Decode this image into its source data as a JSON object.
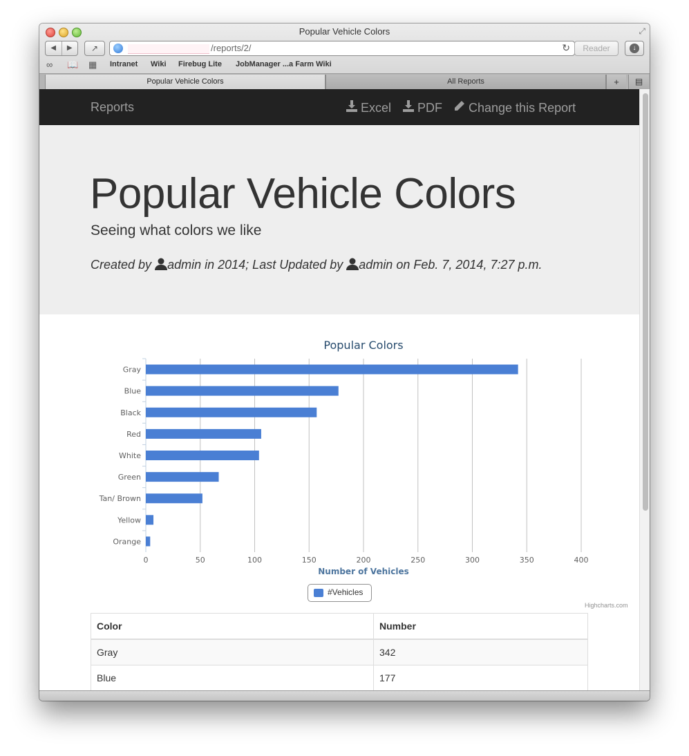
{
  "window": {
    "title": "Popular Vehicle Colors",
    "url": "/reports/2/",
    "reader_label": "Reader"
  },
  "bookmarks": [
    "Intranet",
    "Wiki",
    "Firebug Lite",
    "JobManager ...a Farm Wiki"
  ],
  "tabs": [
    {
      "label": "Popular Vehicle Colors",
      "active": true
    },
    {
      "label": "All Reports",
      "active": false
    }
  ],
  "navbar": {
    "brand": "Reports",
    "links": [
      {
        "label": "Excel",
        "icon": "download-icon"
      },
      {
        "label": "PDF",
        "icon": "download-icon"
      },
      {
        "label": "Change this Report",
        "icon": "pencil-icon"
      }
    ]
  },
  "hero": {
    "title": "Popular Vehicle Colors",
    "subtitle": "Seeing what colors we like",
    "meta": {
      "created_prefix": "Created by",
      "created_user": "admin",
      "created_year_text": "in 2014; Last Updated by",
      "updated_user": "admin",
      "updated_text": "on Feb. 7, 2014, 7:27 p.m."
    }
  },
  "chart_data": {
    "type": "bar",
    "orientation": "horizontal",
    "title": "Popular Colors",
    "xlabel": "Number of Vehicles",
    "categories": [
      "Gray",
      "Blue",
      "Black",
      "Red",
      "White",
      "Green",
      "Tan/ Brown",
      "Yellow",
      "Orange"
    ],
    "series": [
      {
        "name": "#Vehicles",
        "values": [
          342,
          177,
          157,
          106,
          104,
          67,
          52,
          7,
          4
        ],
        "color": "#4a7fd4"
      }
    ],
    "xlim": [
      0,
      400
    ],
    "ticks": [
      0,
      50,
      100,
      150,
      200,
      250,
      300,
      350,
      400
    ],
    "grid": true,
    "legend": "bottom-center",
    "credits": "Highcharts.com"
  },
  "table": {
    "headers": [
      "Color",
      "Number"
    ],
    "rows": [
      [
        "Gray",
        "342"
      ],
      [
        "Blue",
        "177"
      ]
    ]
  }
}
